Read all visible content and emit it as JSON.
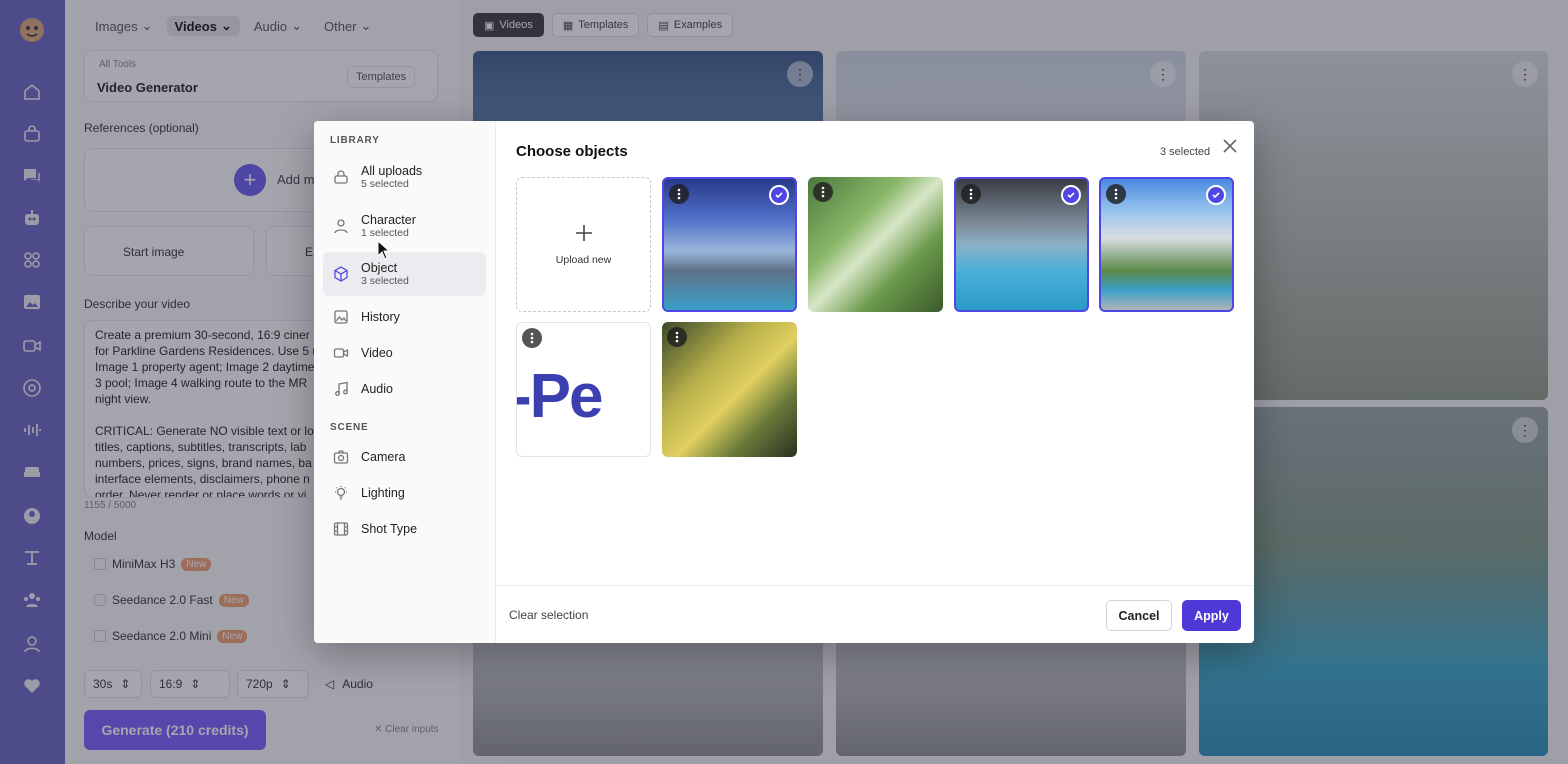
{
  "rail_icons": [
    "logo-icon",
    "home-icon",
    "bag-icon",
    "chat-icon",
    "bot-icon",
    "apps-icon",
    "image-icon",
    "video-icon",
    "at-icon",
    "wave-icon",
    "sofa-icon",
    "user-circle-icon",
    "tools-icon",
    "group-icon",
    "person-icon",
    "heart-icon"
  ],
  "topnav": [
    {
      "label": "Images"
    },
    {
      "label": "Videos"
    },
    {
      "label": "Audio"
    },
    {
      "label": "Other"
    }
  ],
  "tool": {
    "breadcrumb": "All Tools",
    "title": "Video Generator",
    "templates": "Templates"
  },
  "refs": {
    "label": "References (optional)",
    "add": "Add m"
  },
  "frames": {
    "start": "Start image",
    "end": "E"
  },
  "describe": {
    "label": "Describe your video",
    "text": "Create a premium 30-second, 16:9 ciner\nfor Parkline Gardens Residences. Use 5 u\nImage 1 property agent; Image 2 daytime\n3 pool; Image 4 walking route to the MR\nnight view.\n\nCRITICAL: Generate NO visible text or lo\ntitles, captions, subtitles, transcripts, lab\nnumbers, prices, signs, brand names, ba\ninterface elements, disclaimers, phone n\norder. Never render or place words or vi",
    "counter": "1155 / 5000"
  },
  "model": {
    "label": "Model",
    "items": [
      {
        "name": "MiniMax H3",
        "badge": "New"
      },
      {
        "name": "Seedance 2.0 Fast",
        "badge": "New"
      },
      {
        "name": "Seedance 2.0 Mini",
        "badge": "New"
      }
    ]
  },
  "settings": {
    "duration": "30s",
    "ratio": "16:9",
    "resolution": "720p",
    "audio": "Audio"
  },
  "generate": "Generate (210 credits)",
  "clear_inputs": "Clear inputs",
  "gallery_tabs": [
    {
      "label": "Videos"
    },
    {
      "label": "Templates"
    },
    {
      "label": "Examples"
    }
  ],
  "modal": {
    "library_head": "LIBRARY",
    "scene_head": "SCENE",
    "library": [
      {
        "label": "All uploads",
        "sub": "5 selected",
        "icon": "lock-stack-icon"
      },
      {
        "label": "Character",
        "sub": "1 selected",
        "icon": "person-icon"
      },
      {
        "label": "Object",
        "sub": "3 selected",
        "icon": "cube-icon"
      },
      {
        "label": "History",
        "icon": "image-icon"
      },
      {
        "label": "Video",
        "icon": "video-icon"
      },
      {
        "label": "Audio",
        "icon": "music-icon"
      }
    ],
    "scene": [
      {
        "label": "Camera",
        "icon": "camera-icon"
      },
      {
        "label": "Lighting",
        "icon": "bulb-icon"
      },
      {
        "label": "Shot Type",
        "icon": "film-icon"
      }
    ],
    "title": "Choose objects",
    "count": "3 selected",
    "upload": "Upload new",
    "image_text": "-Pe",
    "clear": "Clear selection",
    "cancel": "Cancel",
    "apply": "Apply"
  }
}
